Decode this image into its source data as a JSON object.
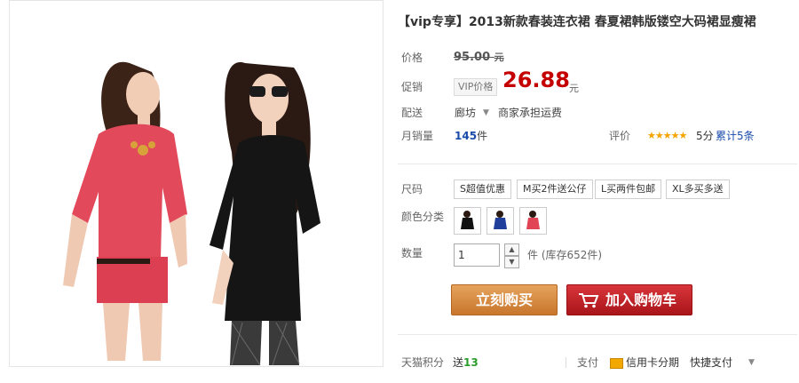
{
  "product": {
    "title": "【vip专享】2013新款春装连衣裙 春夏裙韩版镂空大码裙显瘦裙"
  },
  "price": {
    "label": "价格",
    "original": "95.00",
    "currency": "元"
  },
  "promo": {
    "label": "促销",
    "tag": "VIP价格",
    "price": "26.88",
    "currency": "元"
  },
  "delivery": {
    "label": "配送",
    "location": "廊坊",
    "shipping": "商家承担运费"
  },
  "sales": {
    "label": "月销量",
    "count": "145",
    "unit": "件",
    "rating_label": "评价",
    "stars": "★★★★★",
    "score": "5分",
    "reviews": "累计5条"
  },
  "size": {
    "label": "尺码",
    "options": [
      "S超值优惠",
      "M买2件送公仔",
      "L买两件包邮",
      "XL多买多送"
    ]
  },
  "color": {
    "label": "颜色分类",
    "swatches": [
      "black-dress",
      "blue-dress",
      "red-dress"
    ]
  },
  "quantity": {
    "label": "数量",
    "value": "1",
    "stock": "件 (库存652件)"
  },
  "actions": {
    "buy_now": "立刻购买",
    "add_to_cart": "加入购物车"
  },
  "footer": {
    "points_label": "天猫积分",
    "points_prefix": "送",
    "points_value": "13",
    "pay_label": "支付",
    "credit_card": "信用卡分期",
    "quick_pay": "快捷支付"
  },
  "colors": {
    "price_red": "#c40000",
    "buy_orange": "#d08a3e",
    "cart_red": "#c0262b",
    "star_gold": "#f5a400",
    "link_blue": "#1a4bab"
  }
}
